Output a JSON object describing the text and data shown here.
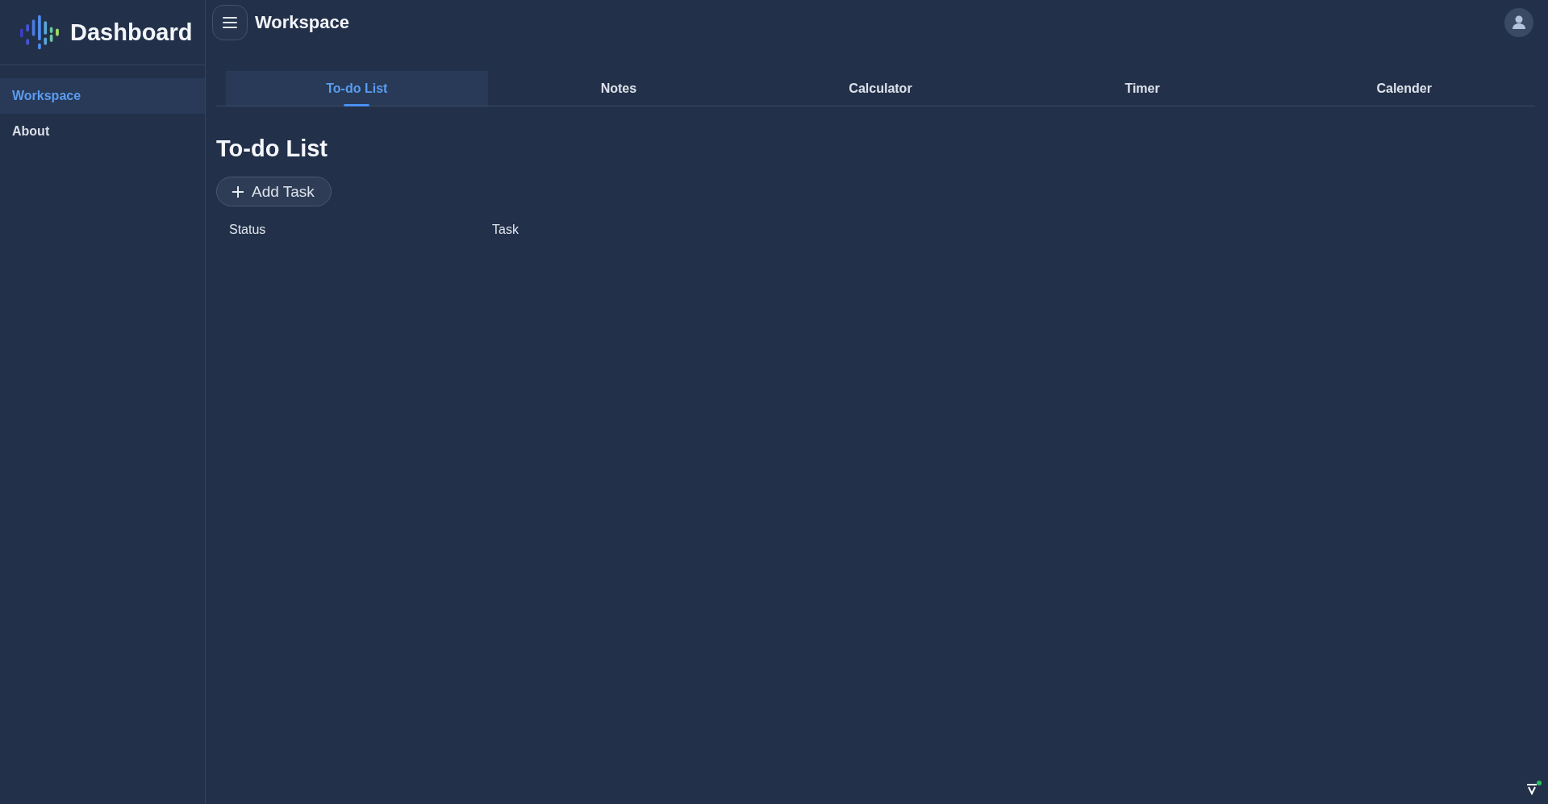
{
  "sidebar": {
    "title": "Dashboard",
    "items": [
      {
        "label": "Workspace",
        "selected": true
      },
      {
        "label": "About",
        "selected": false
      }
    ]
  },
  "header": {
    "title": "Workspace"
  },
  "tabs": [
    {
      "label": "To-do List",
      "selected": true
    },
    {
      "label": "Notes",
      "selected": false
    },
    {
      "label": "Calculator",
      "selected": false
    },
    {
      "label": "Timer",
      "selected": false
    },
    {
      "label": "Calender",
      "selected": false
    }
  ],
  "todo": {
    "heading": "To-do List",
    "add_button": "Add Task",
    "columns": [
      "Status",
      "Task"
    ]
  }
}
